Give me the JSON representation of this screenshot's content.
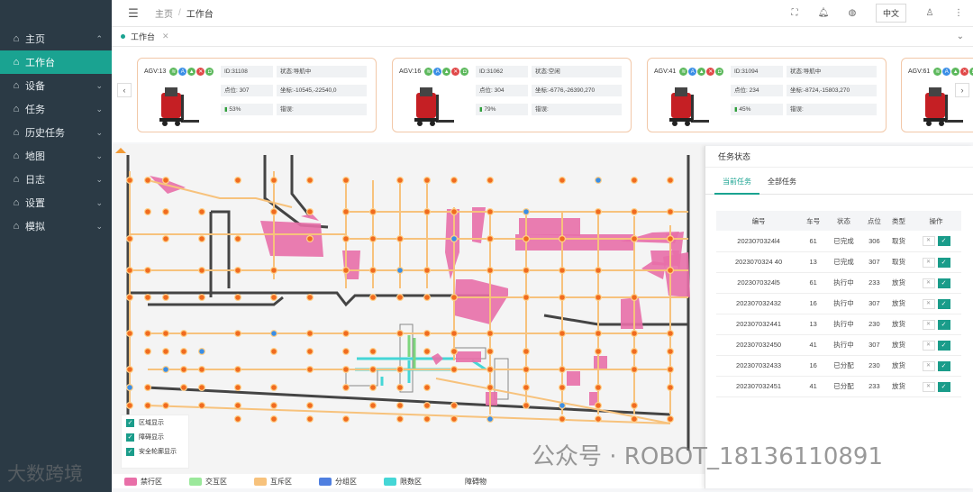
{
  "sidebar": {
    "items": [
      {
        "label": "主页",
        "icon": "home-icon",
        "chevron": "⌃",
        "active": false
      },
      {
        "label": "工作台",
        "icon": "home-icon",
        "chevron": "",
        "active": true
      },
      {
        "label": "设备",
        "icon": "home-icon",
        "chevron": "⌄",
        "active": false
      },
      {
        "label": "任务",
        "icon": "home-icon",
        "chevron": "⌄",
        "active": false
      },
      {
        "label": "历史任务",
        "icon": "home-icon",
        "chevron": "⌄",
        "active": false
      },
      {
        "label": "地图",
        "icon": "home-icon",
        "chevron": "⌄",
        "active": false
      },
      {
        "label": "日志",
        "icon": "home-icon",
        "chevron": "⌄",
        "active": false
      },
      {
        "label": "设置",
        "icon": "home-icon",
        "chevron": "⌄",
        "active": false
      },
      {
        "label": "模拟",
        "icon": "home-icon",
        "chevron": "⌄",
        "active": false
      }
    ]
  },
  "header": {
    "breadcrumb_home": "主页",
    "breadcrumb_sep": "/",
    "breadcrumb_current": "工作台",
    "lang_button": "中文"
  },
  "tabs": {
    "active_label": "工作台"
  },
  "agvs": [
    {
      "name": "AGV:13",
      "id": "ID:31108",
      "status": "状态:导航中",
      "point": "点位: 307",
      "coord": "坐标:-10545,-22540,0",
      "battery": "53%",
      "error": "错误:"
    },
    {
      "name": "AGV:16",
      "id": "ID:31062",
      "status": "状态:空闲",
      "point": "点位: 304",
      "coord": "坐标:-6776,-26390,270",
      "battery": "79%",
      "error": "错误:"
    },
    {
      "name": "AGV:41",
      "id": "ID:31094",
      "status": "状态:导航中",
      "point": "点位: 234",
      "coord": "坐标:-8724,-15803,270",
      "battery": "45%",
      "error": "错误:"
    },
    {
      "name": "AGV:61",
      "id": "",
      "status": "",
      "point": "",
      "coord": "",
      "battery": "",
      "error": ""
    }
  ],
  "legend": {
    "items": [
      "区域显示",
      "障碍显示",
      "安全轮廓显示"
    ]
  },
  "zones": [
    {
      "label": "禁行区",
      "color": "#e86fa8"
    },
    {
      "label": "交互区",
      "color": "#9be89b"
    },
    {
      "label": "互斥区",
      "color": "#f7c27c"
    },
    {
      "label": "分组区",
      "color": "#4f7fe0"
    },
    {
      "label": "限数区",
      "color": "#45d6d6"
    },
    {
      "label": "障碍物",
      "color": ""
    }
  ],
  "task_panel": {
    "title": "任务状态",
    "tab_current": "当前任务",
    "tab_all": "全部任务",
    "columns": [
      "编号",
      "车号",
      "状态",
      "点位",
      "类型",
      "操作"
    ],
    "rows": [
      [
        "2023070324l4",
        "61",
        "已完成",
        "306",
        "取货"
      ],
      [
        "2023070324 40",
        "13",
        "已完成",
        "307",
        "取货"
      ],
      [
        "2023070324l5",
        "61",
        "执行中",
        "233",
        "放货"
      ],
      [
        "202307032432",
        "16",
        "执行中",
        "307",
        "放货"
      ],
      [
        "202307032441",
        "13",
        "执行中",
        "230",
        "放货"
      ],
      [
        "202307032450",
        "41",
        "执行中",
        "307",
        "放货"
      ],
      [
        "202307032433",
        "16",
        "已分配",
        "230",
        "放货"
      ],
      [
        "202307032451",
        "41",
        "已分配",
        "233",
        "放货"
      ]
    ]
  },
  "watermark": {
    "right": "公众号 · ROBOT_18136110891",
    "left": "大数跨境"
  }
}
